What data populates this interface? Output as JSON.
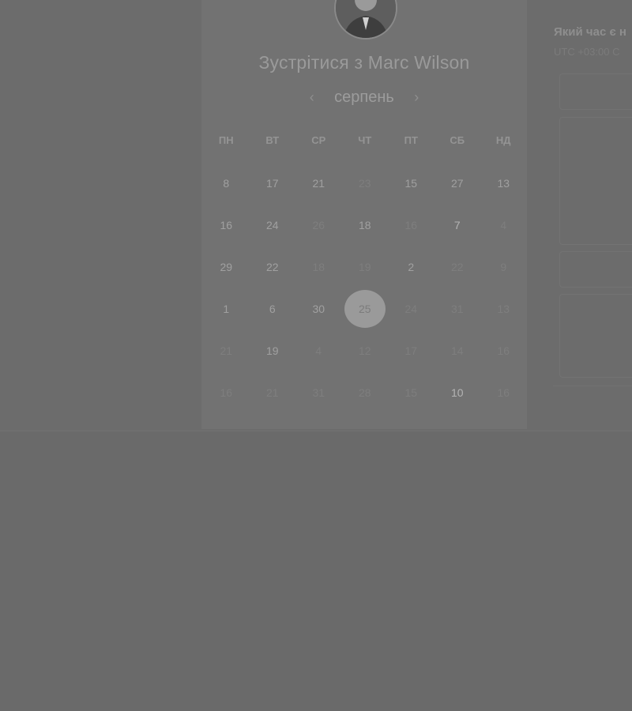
{
  "header": {
    "title": "Зустрітися з Marc Wilson",
    "avatar_icon": "person-avatar-icon"
  },
  "calendar": {
    "month": "серпень",
    "prev_icon": "chevron-left-icon",
    "next_icon": "chevron-right-icon",
    "weekdays": [
      "ПН",
      "ВТ",
      "СР",
      "ЧТ",
      "ПТ",
      "СБ",
      "НД"
    ],
    "weeks": [
      [
        "8",
        "17",
        "21",
        "23",
        "15",
        "27",
        "13"
      ],
      [
        "16",
        "24",
        "26",
        "18",
        "16",
        "7",
        "4"
      ],
      [
        "29",
        "22",
        "18",
        "19",
        "2",
        "22",
        "9"
      ],
      [
        "1",
        "6",
        "30",
        "25",
        "24",
        "31",
        "13"
      ],
      [
        "21",
        "19",
        "4",
        "12",
        "17",
        "14",
        "16"
      ],
      [
        "16",
        "21",
        "31",
        "28",
        "15",
        "10",
        "16"
      ]
    ],
    "selected": "25"
  },
  "right_panel": {
    "title": "Який час є н",
    "timezone": "UTC +03:00 C"
  }
}
